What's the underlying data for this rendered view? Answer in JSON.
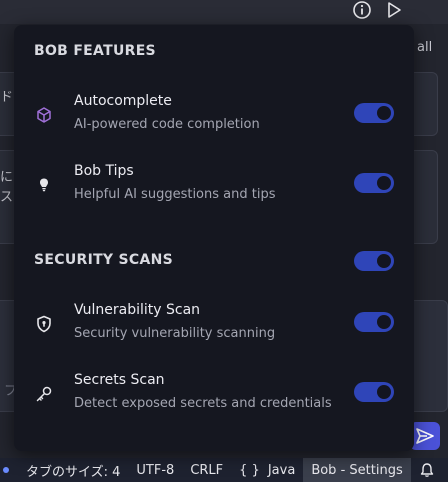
{
  "background": {
    "top_icons": [
      "info-icon",
      "play-icon"
    ],
    "fragment_right_top": "all",
    "fragment_left_1": "ド",
    "fragment_left_2": "に",
    "fragment_left_3": "ス",
    "fragment_left_4": "フ"
  },
  "popup": {
    "section_bob": "BOB FEATURES",
    "section_security": "SECURITY SCANS",
    "items": [
      {
        "title": "Autocomplete",
        "desc": "AI-powered code completion",
        "icon": "cube-icon",
        "enabled": true
      },
      {
        "title": "Bob Tips",
        "desc": "Helpful AI suggestions and tips",
        "icon": "lightbulb-icon",
        "enabled": true
      },
      {
        "title": "Vulnerability Scan",
        "desc": "Security vulnerability scanning",
        "icon": "shield-icon",
        "enabled": true
      },
      {
        "title": "Secrets Scan",
        "desc": "Detect exposed secrets and credentials",
        "icon": "key-icon",
        "enabled": true
      }
    ],
    "security_enabled": true
  },
  "statusbar": {
    "tab_size": "タブのサイズ: 4",
    "encoding": "UTF-8",
    "eol": "CRLF",
    "language_icon": "{ }",
    "language": "Java",
    "bob_settings": "Bob - Settings",
    "bell": "bell-icon"
  },
  "colors": {
    "accent": "#2f45b8",
    "popup_bg": "#151720",
    "autocomplete_icon": "#a070d8"
  }
}
